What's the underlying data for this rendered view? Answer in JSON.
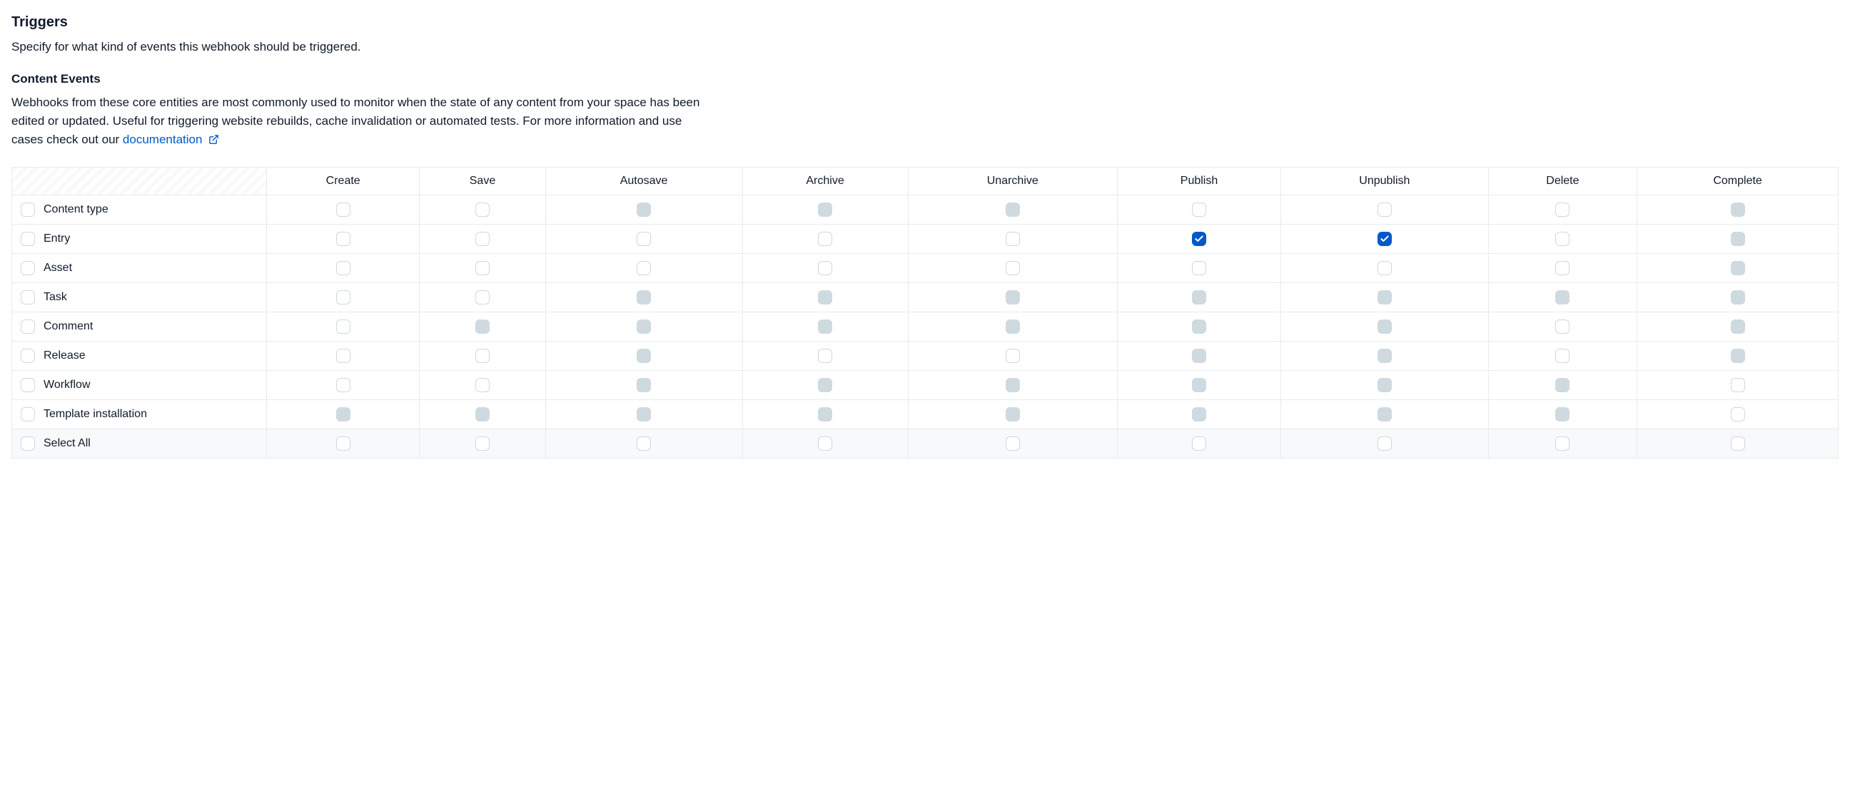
{
  "section": {
    "title": "Triggers",
    "description": "Specify for what kind of events this webhook should be triggered.",
    "sub_title": "Content Events",
    "sub_description": "Webhooks from these core entities are most commonly used to monitor when the state of any content from your space has been edited or updated. Useful for triggering website rebuilds, cache invalidation or automated tests. For more information and use cases check out our ",
    "doc_link_text": "documentation"
  },
  "columns": [
    "Create",
    "Save",
    "Autosave",
    "Archive",
    "Unarchive",
    "Publish",
    "Unpublish",
    "Delete",
    "Complete"
  ],
  "rows": [
    {
      "label": "Content type",
      "row_state": "unchecked",
      "cells": [
        "unchecked",
        "unchecked",
        "disabled",
        "disabled",
        "disabled",
        "unchecked",
        "unchecked",
        "unchecked",
        "disabled"
      ]
    },
    {
      "label": "Entry",
      "row_state": "unchecked",
      "cells": [
        "unchecked",
        "unchecked",
        "unchecked",
        "unchecked",
        "unchecked",
        "checked",
        "checked",
        "unchecked",
        "disabled"
      ]
    },
    {
      "label": "Asset",
      "row_state": "unchecked",
      "cells": [
        "unchecked",
        "unchecked",
        "unchecked",
        "unchecked",
        "unchecked",
        "unchecked",
        "unchecked",
        "unchecked",
        "disabled"
      ]
    },
    {
      "label": "Task",
      "row_state": "unchecked",
      "cells": [
        "unchecked",
        "unchecked",
        "disabled",
        "disabled",
        "disabled",
        "disabled",
        "disabled",
        "disabled",
        "disabled"
      ]
    },
    {
      "label": "Comment",
      "row_state": "unchecked",
      "cells": [
        "unchecked",
        "disabled",
        "disabled",
        "disabled",
        "disabled",
        "disabled",
        "disabled",
        "unchecked",
        "disabled"
      ]
    },
    {
      "label": "Release",
      "row_state": "unchecked",
      "cells": [
        "unchecked",
        "unchecked",
        "disabled",
        "unchecked",
        "unchecked",
        "disabled",
        "disabled",
        "unchecked",
        "disabled"
      ]
    },
    {
      "label": "Workflow",
      "row_state": "unchecked",
      "cells": [
        "unchecked",
        "unchecked",
        "disabled",
        "disabled",
        "disabled",
        "disabled",
        "disabled",
        "disabled",
        "unchecked"
      ]
    },
    {
      "label": "Template installation",
      "row_state": "unchecked",
      "cells": [
        "disabled",
        "disabled",
        "disabled",
        "disabled",
        "disabled",
        "disabled",
        "disabled",
        "disabled",
        "unchecked"
      ]
    }
  ],
  "select_all": {
    "label": "Select All",
    "row_state": "unchecked",
    "cells": [
      "unchecked",
      "unchecked",
      "unchecked",
      "unchecked",
      "unchecked",
      "unchecked",
      "unchecked",
      "unchecked",
      "unchecked"
    ]
  }
}
